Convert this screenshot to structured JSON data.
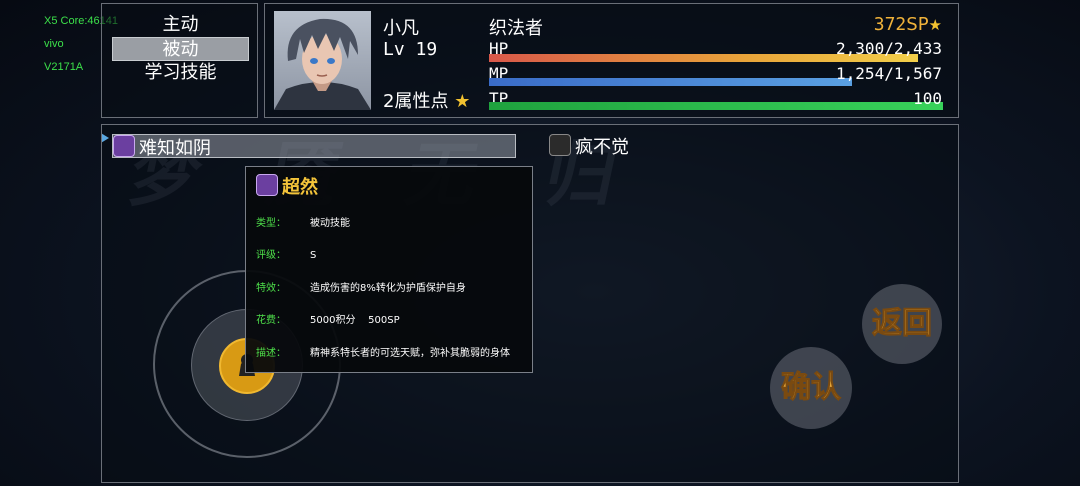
{
  "system_overlay": {
    "line1": "X5 Core:46141",
    "line2": "vivo",
    "line3": "V2171A"
  },
  "menu": {
    "items": [
      {
        "label": "主动"
      },
      {
        "label": "被动"
      },
      {
        "label": "学习技能"
      }
    ],
    "selected_index": 1
  },
  "character": {
    "name": "小凡",
    "level": "Lv 19",
    "class": "织法者",
    "sp": "372",
    "sp_unit": "SP",
    "sp_icon": "star-pair-icon",
    "attribute_points": "2属性点",
    "hp": {
      "label": "HP",
      "value": "2,300/2,433",
      "fraction": 0.945
    },
    "mp": {
      "label": "MP",
      "value": "1,254/1,567",
      "fraction": 0.8
    },
    "tp": {
      "label": "TP",
      "value": "100",
      "fraction": 1.0
    }
  },
  "skills": [
    {
      "name": "难知如阴",
      "icon": "purple-skull-icon",
      "selected": true
    },
    {
      "name": "疯不觉",
      "icon": "serpent-icon",
      "selected": false
    }
  ],
  "tooltip": {
    "title": "超然",
    "icon": "purple-skull-icon",
    "rows": [
      {
        "key": "类型：",
        "value": "被动技能"
      },
      {
        "key": "评级：",
        "value": "S"
      },
      {
        "key": "特效：",
        "value": "造成伤害的8%转化为护盾保护自身"
      },
      {
        "key": "花费：",
        "value": "5000积分    500SP"
      },
      {
        "key": "描述：",
        "value": "精神系特长者的可选天赋，弥补其脆弱的身体"
      }
    ]
  },
  "buttons": {
    "back": "返回",
    "confirm": "确认"
  },
  "colors": {
    "hp": "#e8a43a",
    "mp": "#4a8fd8",
    "tp": "#2ec24a",
    "sp_text": "#f0b23a",
    "label_green": "#4ee04a"
  }
}
